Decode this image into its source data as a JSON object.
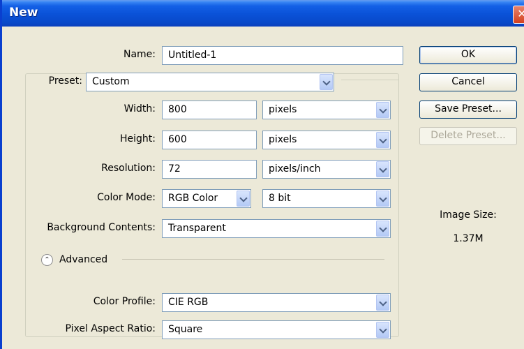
{
  "window": {
    "title": "New",
    "close_glyph": "✕"
  },
  "form": {
    "name": {
      "label": "Name:",
      "value": "Untitled-1"
    },
    "preset": {
      "label": "Preset:",
      "value": "Custom"
    },
    "width": {
      "label": "Width:",
      "value": "800",
      "unit": "pixels"
    },
    "height": {
      "label": "Height:",
      "value": "600",
      "unit": "pixels"
    },
    "resolution": {
      "label": "Resolution:",
      "value": "72",
      "unit": "pixels/inch"
    },
    "color_mode": {
      "label": "Color Mode:",
      "value": "RGB Color",
      "depth": "8 bit"
    },
    "background": {
      "label": "Background Contents:",
      "value": "Transparent"
    },
    "advanced": {
      "label": "Advanced",
      "toggle_icon": "collapse-up-icon",
      "glyph": "⌃"
    },
    "color_profile": {
      "label": "Color Profile:",
      "value": "CIE RGB"
    },
    "pixel_aspect": {
      "label": "Pixel Aspect Ratio:",
      "value": "Square"
    }
  },
  "buttons": {
    "ok": "OK",
    "cancel": "Cancel",
    "save_preset": "Save Preset...",
    "delete_preset": "Delete Preset..."
  },
  "image_size": {
    "label": "Image Size:",
    "value": "1.37M"
  },
  "colors": {
    "titlebar": "#0a52d8",
    "window_bg": "#ece9d8",
    "field_border": "#7f9db9",
    "close_button": "#d4411f"
  }
}
